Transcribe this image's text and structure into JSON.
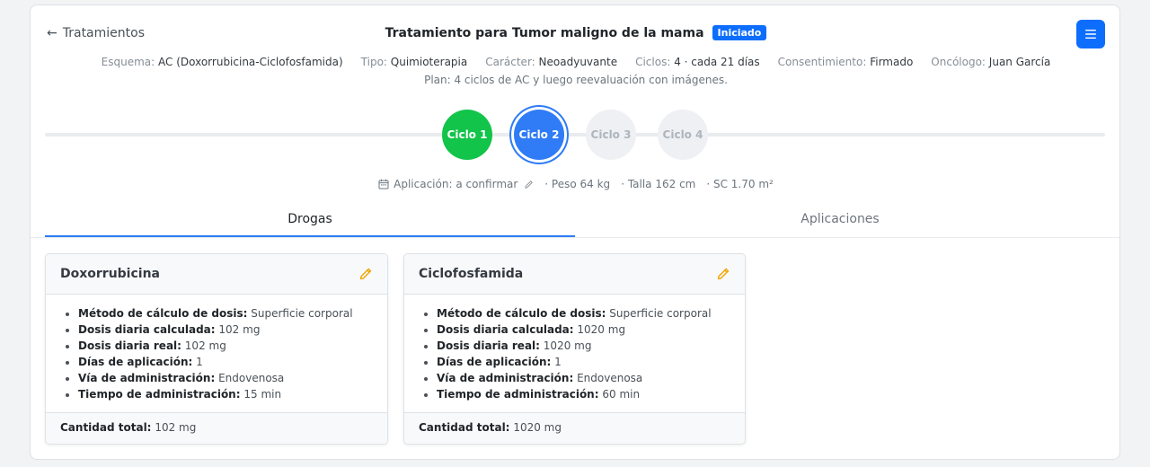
{
  "header": {
    "back_label": "Tratamientos",
    "title": "Tratamiento para Tumor maligno de la mama",
    "status_badge": "Iniciado"
  },
  "meta": {
    "esquema_label": "Esquema:",
    "esquema_value": "AC (Doxorrubicina-Ciclofosfamida)",
    "tipo_label": "Tipo:",
    "tipo_value": "Quimioterapia",
    "caracter_label": "Carácter:",
    "caracter_value": "Neoadyuvante",
    "ciclos_label": "Ciclos:",
    "ciclos_value": "4 · cada 21 días",
    "consentimiento_label": "Consentimiento:",
    "consentimiento_value": "Firmado",
    "oncologo_label": "Oncólogo:",
    "oncologo_value": "Juan García",
    "plan": "Plan: 4 ciclos de AC y luego reevaluación con imágenes."
  },
  "cycles": [
    {
      "label": "Ciclo 1",
      "state": "done"
    },
    {
      "label": "Ciclo 2",
      "state": "current"
    },
    {
      "label": "Ciclo 3",
      "state": "pending"
    },
    {
      "label": "Ciclo 4",
      "state": "pending"
    }
  ],
  "cycle_info": {
    "application": "Aplicación: a confirmar",
    "weight": "· Peso 64 kg",
    "height": "· Talla 162 cm",
    "surface": "· SC 1.70 m²"
  },
  "tabs": [
    {
      "label": "Drogas",
      "active": true
    },
    {
      "label": "Aplicaciones",
      "active": false
    }
  ],
  "drugs": [
    {
      "name": "Doxorrubicina",
      "details": [
        {
          "label": "Método de cálculo de dosis:",
          "value": "Superficie corporal"
        },
        {
          "label": "Dosis diaria calculada:",
          "value": "102 mg"
        },
        {
          "label": "Dosis diaria real:",
          "value": "102 mg"
        },
        {
          "label": "Días de aplicación:",
          "value": "1"
        },
        {
          "label": "Vía de administración:",
          "value": "Endovenosa"
        },
        {
          "label": "Tiempo de administración:",
          "value": "15 min"
        }
      ],
      "total_label": "Cantidad total:",
      "total_value": "102 mg"
    },
    {
      "name": "Ciclofosfamida",
      "details": [
        {
          "label": "Método de cálculo de dosis:",
          "value": "Superficie corporal"
        },
        {
          "label": "Dosis diaria calculada:",
          "value": "1020 mg"
        },
        {
          "label": "Dosis diaria real:",
          "value": "1020 mg"
        },
        {
          "label": "Días de aplicación:",
          "value": "1"
        },
        {
          "label": "Vía de administración:",
          "value": "Endovenosa"
        },
        {
          "label": "Tiempo de administración:",
          "value": "60 min"
        }
      ],
      "total_label": "Cantidad total:",
      "total_value": "1020 mg"
    }
  ],
  "colors": {
    "primary": "#0d6efd",
    "cycle_done": "#12c449",
    "cycle_current": "#2f7cf6",
    "edit_icon": "#f0a500"
  },
  "icons": {
    "back": "arrow-left-icon",
    "menu": "menu-icon",
    "calendar": "calendar-icon",
    "pencil": "pencil-icon"
  }
}
